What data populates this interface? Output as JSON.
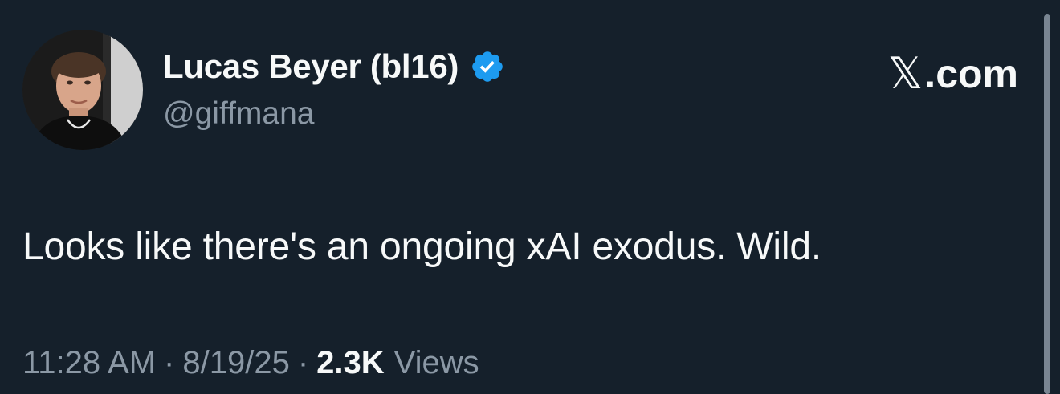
{
  "tweet": {
    "author": {
      "display_name": "Lucas Beyer (bl16)",
      "handle": "@giffmana",
      "verified": true,
      "avatar_icon": "profile-photo"
    },
    "brand": {
      "x_glyph": "𝕏",
      "suffix": ".com"
    },
    "text": "Looks like there's an ongoing xAI exodus. Wild.",
    "meta": {
      "time": "11:28 AM",
      "separator": "·",
      "date": "8/19/25",
      "views_count": "2.3K",
      "views_label": "Views"
    },
    "colors": {
      "background": "#15202b",
      "primary_text": "#f7f9f9",
      "secondary_text": "#8b98a5",
      "verified_badge": "#1d9bf0"
    }
  }
}
